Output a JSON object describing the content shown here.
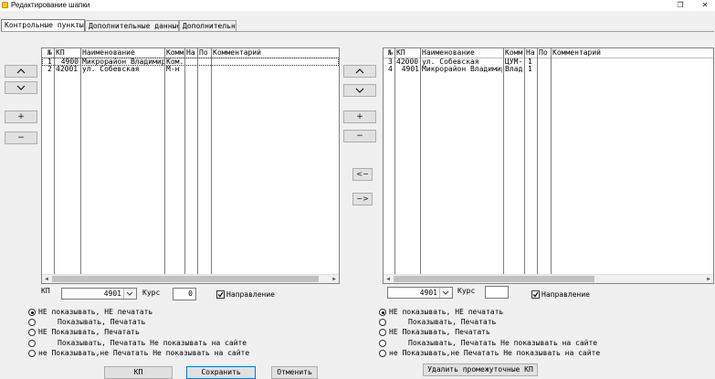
{
  "window": {
    "title": "Редактирование шапки",
    "maximize_glyph": "❐",
    "close_glyph": "✕"
  },
  "tabs": [
    {
      "label": "Контрольные пункты"
    },
    {
      "label": "Дополнительные данные"
    },
    {
      "label": "Дополнительно"
    }
  ],
  "buttons": {
    "up": "^",
    "down": "v",
    "add": "+",
    "remove": "−",
    "move_left": "<−",
    "move_right": "−>"
  },
  "left_grid": {
    "columns": [
      "№",
      "КП",
      "Наименование",
      "Комм",
      "На",
      "По",
      "Комментарий"
    ],
    "rows": [
      [
        "1",
        "4900",
        "Микрорайон Владимирс",
        "Ком.",
        "",
        "",
        ""
      ],
      [
        "2",
        "42001",
        "ул. Собевская",
        "М-н",
        "",
        "",
        ""
      ]
    ]
  },
  "right_grid": {
    "columns": [
      "№",
      "КП",
      "Наименование",
      "Комм",
      "На",
      "По",
      "Комментарий"
    ],
    "rows": [
      [
        "3",
        "42000",
        "ул. Собевская",
        "ЦУМ-",
        "1",
        "",
        ""
      ],
      [
        "4",
        "4901",
        "Микрорайон Владимирс",
        "Влад",
        "1",
        "",
        ""
      ]
    ]
  },
  "left_controls": {
    "kp_label": "КП",
    "kp_value": "4901",
    "kurs_label": "Курс",
    "kurs_value": "0",
    "direction_label": "Направление"
  },
  "right_controls": {
    "kp_value": "4901",
    "kurs_label": "Курс",
    "kurs_value": "",
    "direction_label": "Направление"
  },
  "radio_options": [
    "НЕ показывать, НЕ печатать",
    "Показывать,     Печатать",
    "НЕ Показывать,     Печатать",
    "Показывать,     Печатать Не показывать на сайте",
    "не Показывать,не Печатать Не показывать на сайте"
  ],
  "bottom_buttons": {
    "kp": "КП",
    "save": "Сохранить",
    "cancel": "Отменить",
    "delete_intermediate": "Удалить промежуточные КП"
  }
}
